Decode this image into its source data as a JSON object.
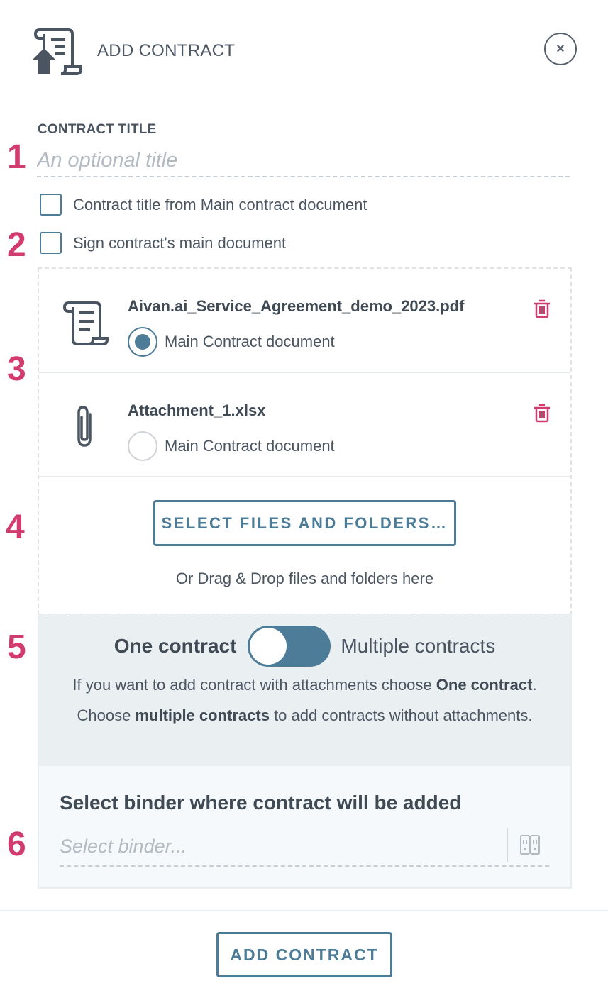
{
  "header": {
    "title": "ADD CONTRACT",
    "close_label": "×"
  },
  "steps": [
    "1",
    "2",
    "3",
    "4",
    "5",
    "6"
  ],
  "contract_title": {
    "label": "CONTRACT TITLE",
    "value": "",
    "placeholder": "An optional title"
  },
  "checkboxes": [
    {
      "label": "Contract title from Main contract document",
      "checked": false
    },
    {
      "label": "Sign contract's main document",
      "checked": false
    }
  ],
  "files": [
    {
      "name": "Aivan.ai_Service_Agreement_demo_2023.pdf",
      "icon": "document-scroll-icon",
      "radio_label": "Main Contract document",
      "main": true
    },
    {
      "name": "Attachment_1.xlsx",
      "icon": "paperclip-icon",
      "radio_label": "Main Contract document",
      "main": false
    }
  ],
  "upload": {
    "button_label": "SELECT FILES AND FOLDERS…",
    "hint": "Or Drag & Drop files and folders here"
  },
  "mode_toggle": {
    "left_label": "One contract",
    "right_label": "Multiple contracts",
    "state": "one",
    "desc_1": "If you want to add contract with attachments choose ",
    "desc_bold_1": "One contract",
    "desc_2": ". Choose ",
    "desc_bold_2": "multiple contracts",
    "desc_3": " to add contracts without attachments."
  },
  "binder": {
    "title": "Select binder where contract will be added",
    "placeholder": "Select binder...",
    "value": "",
    "icon": "binder-icon"
  },
  "footer": {
    "add_button_label": "ADD CONTRACT"
  },
  "colors": {
    "accent": "#4c7c98",
    "step_number": "#d13b6e",
    "delete": "#d13b6e",
    "text": "#4a5561",
    "toggle_bg": "#eaeff2"
  }
}
